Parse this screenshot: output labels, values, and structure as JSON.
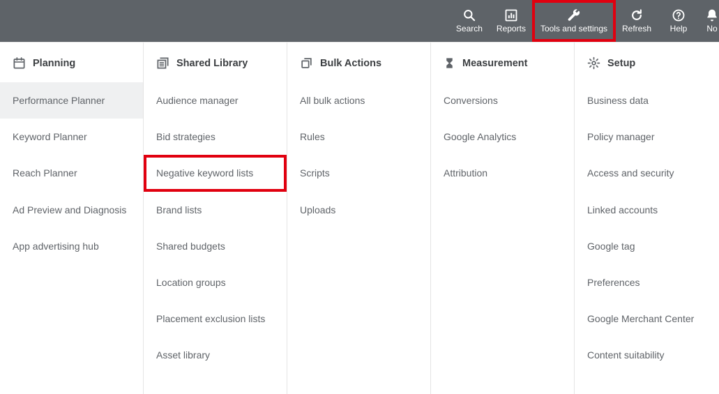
{
  "topbar": {
    "search": "Search",
    "reports": "Reports",
    "tools": "Tools and settings",
    "refresh": "Refresh",
    "help": "Help",
    "notifications": "No"
  },
  "columns": {
    "planning": {
      "title": "Planning",
      "items": [
        "Performance Planner",
        "Keyword Planner",
        "Reach Planner",
        "Ad Preview and Diagnosis",
        "App advertising hub"
      ]
    },
    "shared_library": {
      "title": "Shared Library",
      "items": [
        "Audience manager",
        "Bid strategies",
        "Negative keyword lists",
        "Brand lists",
        "Shared budgets",
        "Location groups",
        "Placement exclusion lists",
        "Asset library"
      ]
    },
    "bulk_actions": {
      "title": "Bulk Actions",
      "items": [
        "All bulk actions",
        "Rules",
        "Scripts",
        "Uploads"
      ]
    },
    "measurement": {
      "title": "Measurement",
      "items": [
        "Conversions",
        "Google Analytics",
        "Attribution"
      ]
    },
    "setup": {
      "title": "Setup",
      "items": [
        "Business data",
        "Policy manager",
        "Access and security",
        "Linked accounts",
        "Google tag",
        "Preferences",
        "Google Merchant Center",
        "Content suitability"
      ]
    }
  }
}
